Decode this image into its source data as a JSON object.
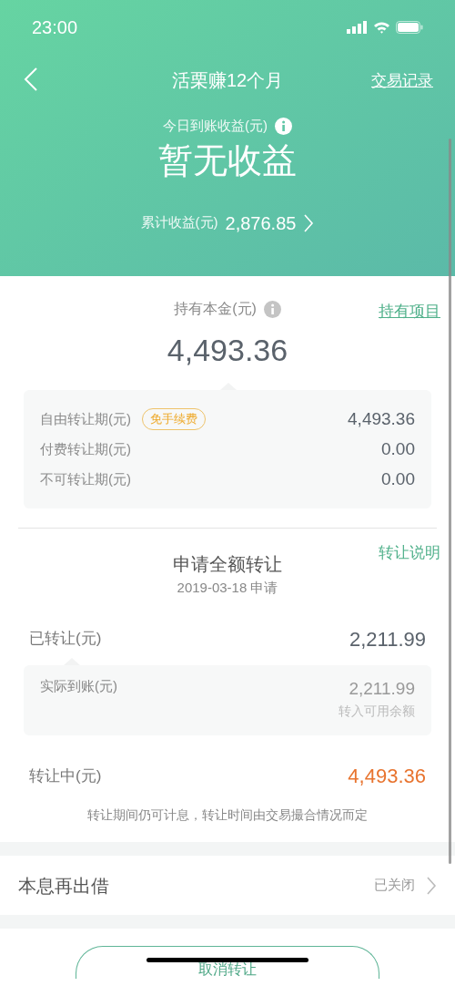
{
  "status_bar": {
    "time": "23:00"
  },
  "nav": {
    "title": "活栗赚12个月",
    "link": "交易记录"
  },
  "earnings": {
    "label": "今日到账收益(元)",
    "value": "暂无收益",
    "total_label": "累计收益(元)",
    "total_value": "2,876.85"
  },
  "holdings": {
    "label": "持有本金(元)",
    "link": "持有项目",
    "value": "4,493.36",
    "rows": [
      {
        "label": "自由转让期(元)",
        "tag": "免手续费",
        "value": "4,493.36"
      },
      {
        "label": "付费转让期(元)",
        "value": "0.00"
      },
      {
        "label": "不可转让期(元)",
        "value": "0.00"
      }
    ]
  },
  "transfer": {
    "title": "申请全额转让",
    "date": "2019-03-18 申请",
    "link": "转让说明",
    "done_label": "已转让(元)",
    "done_value": "2,211.99",
    "received_label": "实际到账(元)",
    "received_value": "2,211.99",
    "received_note": "转入可用余额",
    "pending_label": "转让中(元)",
    "pending_value": "4,493.36",
    "note": "转让期间仍可计息，转让时间由交易撮合情况而定"
  },
  "reinvest": {
    "label": "本息再出借",
    "status": "已关闭"
  },
  "cancel_button": "取消转让"
}
